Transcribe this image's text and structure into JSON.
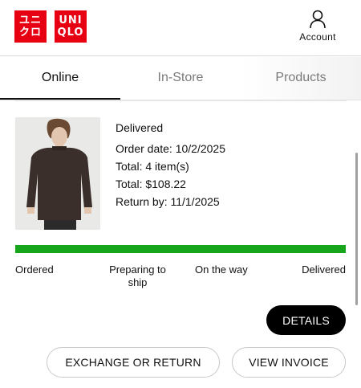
{
  "brand": {
    "logo_ja": "ユニ\nクロ",
    "logo_en": "UNI\nQLO",
    "color": "#e60012"
  },
  "header": {
    "account_label": "Account",
    "account_icon": "user-icon"
  },
  "tabs": [
    {
      "label": "Online",
      "active": true
    },
    {
      "label": "In-Store",
      "active": false
    },
    {
      "label": "Products",
      "active": false
    }
  ],
  "order": {
    "status": "Delivered",
    "order_date": "Order date: 10/2/2025",
    "total_items": "Total: 4 item(s)",
    "total_price": "Total: $108.22",
    "return_by": "Return by: 11/1/2025"
  },
  "progress": {
    "steps": [
      "Ordered",
      "Preparing to ship",
      "On the way",
      "Delivered"
    ],
    "fraction_complete": 1.0,
    "color": "#17a61b"
  },
  "actions": {
    "details": "DETAILS",
    "exchange": "EXCHANGE OR RETURN",
    "invoice": "VIEW INVOICE"
  }
}
